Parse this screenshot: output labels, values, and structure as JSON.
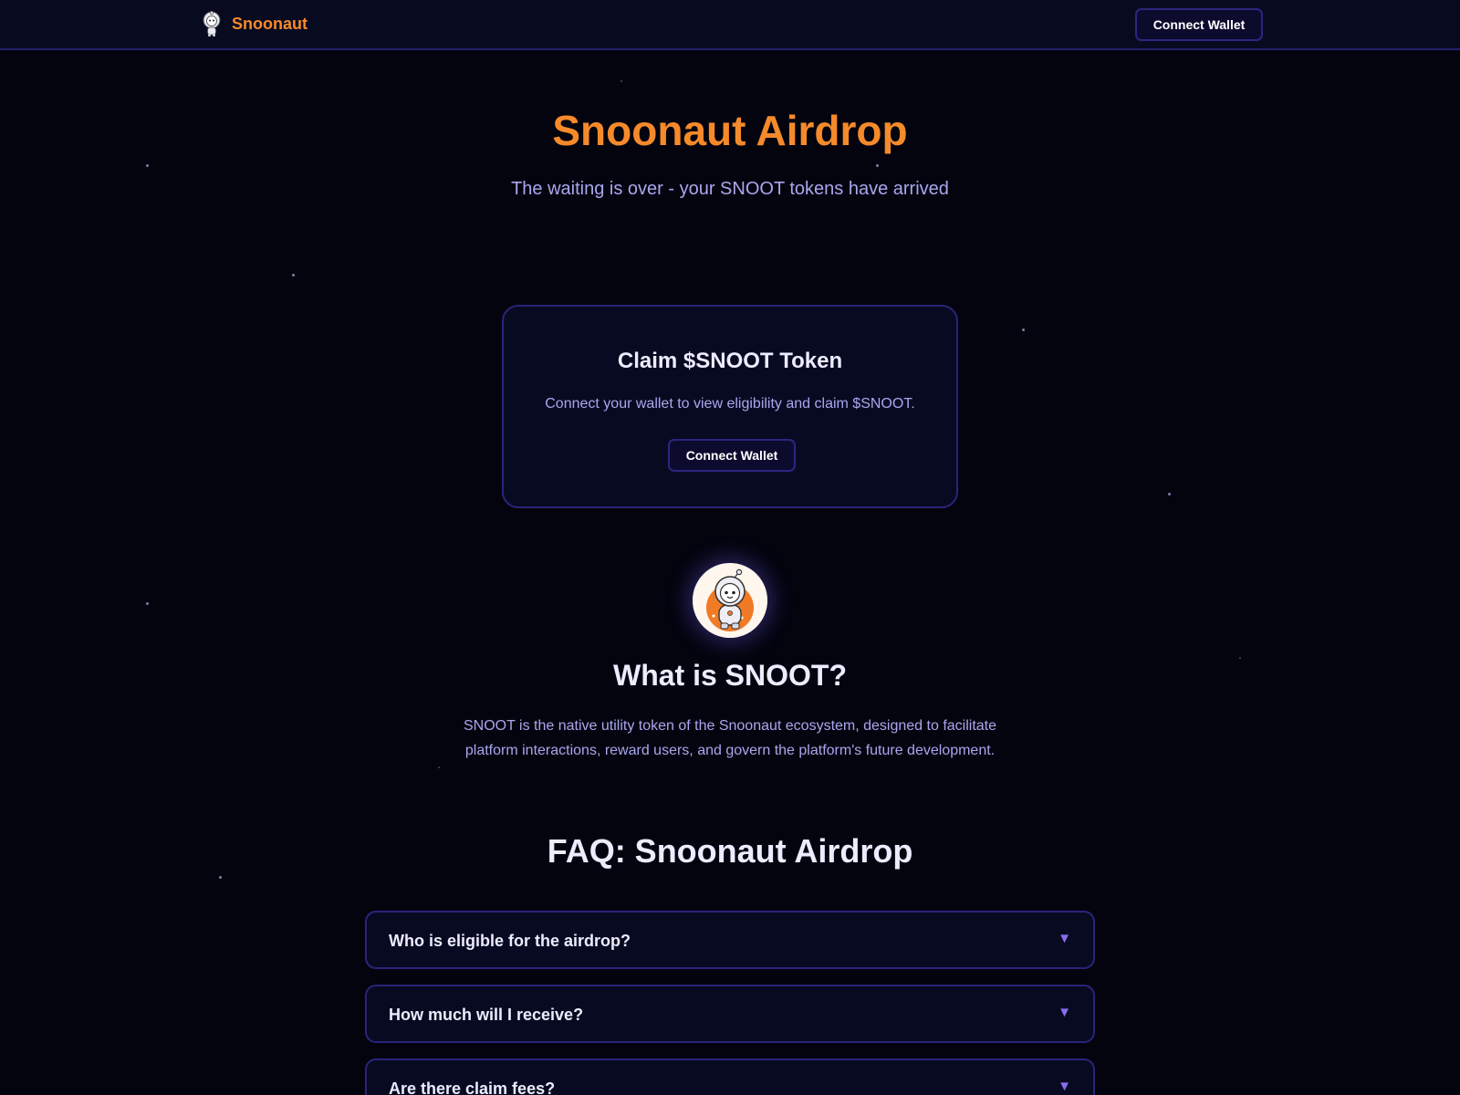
{
  "header": {
    "brand_name": "Snoonaut",
    "connect_label": "Connect Wallet"
  },
  "hero": {
    "title": "Snoonaut Airdrop",
    "subtitle": "The waiting is over - your SNOOT tokens have arrived"
  },
  "claim": {
    "title": "Claim $SNOOT Token",
    "description": "Connect your wallet to view eligibility and claim $SNOOT.",
    "button_label": "Connect Wallet"
  },
  "about": {
    "title": "What is SNOOT?",
    "text": "SNOOT is the native utility token of the Snoonaut ecosystem, designed to facilitate platform interactions, reward users, and govern the platform's future development."
  },
  "faq": {
    "title": "FAQ: Snoonaut Airdrop",
    "items": [
      {
        "question": "Who is eligible for the airdrop?",
        "icon": "chevron-down-icon"
      },
      {
        "question": "How much will I receive?",
        "icon": "chevron-down-icon"
      },
      {
        "question": "Are there claim fees?",
        "icon": "chevron-down-icon"
      }
    ]
  },
  "colors": {
    "accent": "#f58a2a",
    "background": "#04040f",
    "border": "#2a247a",
    "muted_text": "#a9a7ee",
    "chevron": "#8a6cf0"
  }
}
